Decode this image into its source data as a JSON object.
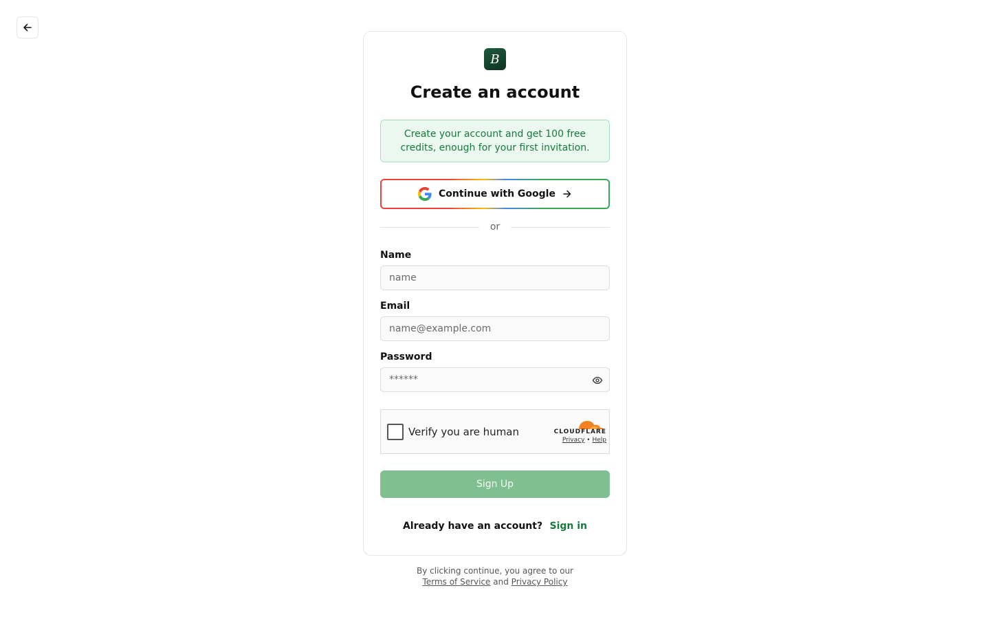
{
  "nav": {
    "back_icon": "arrow-left-icon"
  },
  "brand": {
    "logo_letter": "B",
    "logo_color": "#174a31"
  },
  "title": "Create an account",
  "promo": {
    "text": "Create your account and get 100 free credits, enough for your first invitation."
  },
  "google": {
    "label": "Continue with Google",
    "icon": "google-icon",
    "arrow_icon": "arrow-right-icon"
  },
  "divider_text": "or",
  "form": {
    "name": {
      "label": "Name",
      "value": "",
      "placeholder": "name"
    },
    "email": {
      "label": "Email",
      "value": "",
      "placeholder": "name@example.com"
    },
    "password": {
      "label": "Password",
      "value": "",
      "placeholder": "******",
      "toggle_icon": "eye-icon"
    }
  },
  "captcha": {
    "label": "Verify you are human",
    "brand": "CLOUDFLARE",
    "privacy": "Privacy",
    "separator": "•",
    "help": "Help"
  },
  "signup_label": "Sign Up",
  "signin": {
    "question": "Already have an account?",
    "link": "Sign in"
  },
  "footer": {
    "line1": "By clicking continue, you agree to our",
    "terms": "Terms of Service",
    "and": "and",
    "privacy": "Privacy Policy"
  },
  "colors": {
    "accent_green": "#177a3c",
    "promo_bg": "#ebf8ef",
    "signup_disabled": "#80bf90"
  }
}
